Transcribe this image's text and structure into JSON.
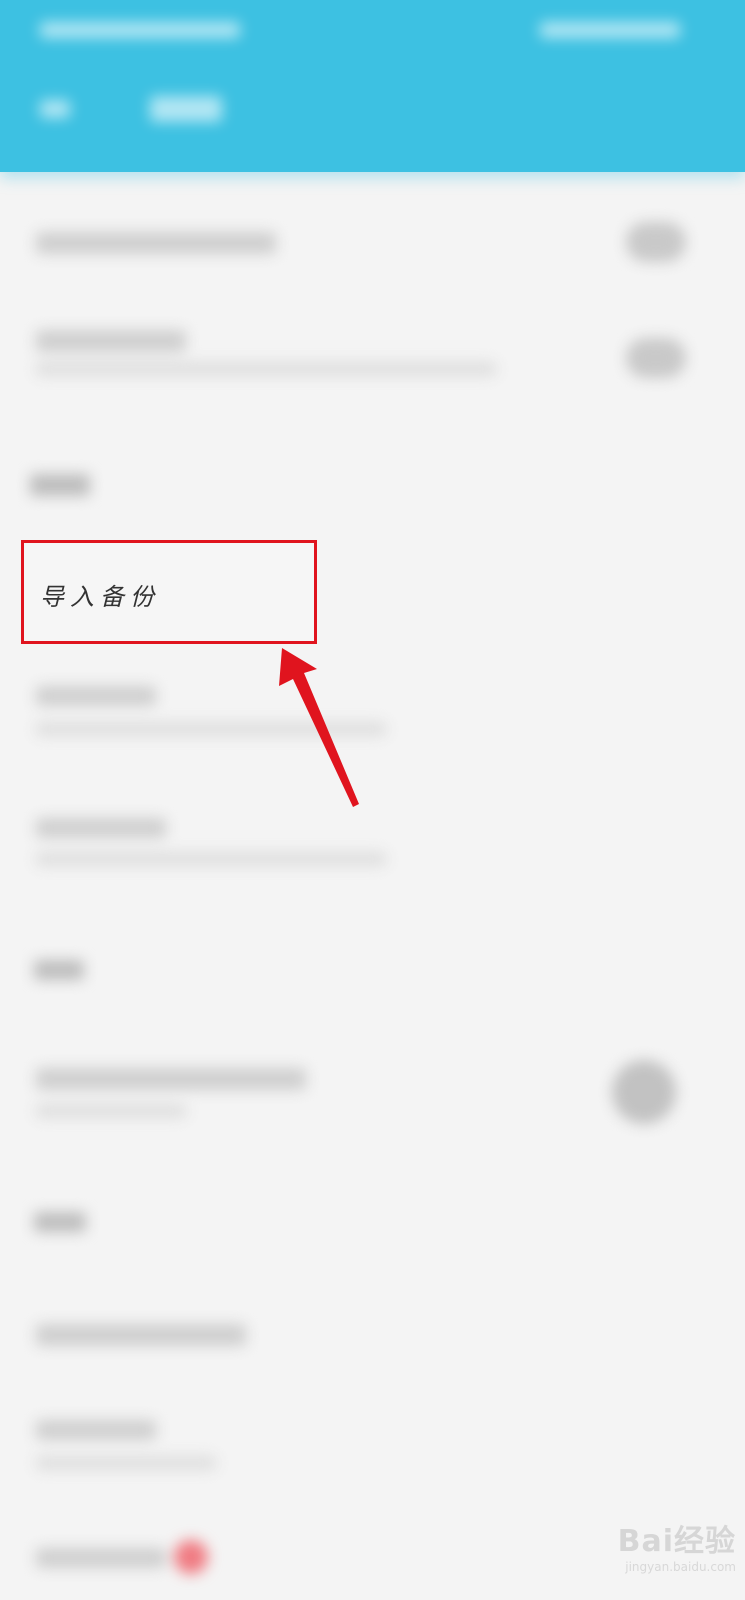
{
  "highlighted_item": {
    "label": "导入备份"
  },
  "watermark": {
    "brand": "Bai经验",
    "sub": "jingyan.baidu.com"
  },
  "colors": {
    "header": "#3dc1e2",
    "highlight_border": "#e0141e",
    "arrow": "#e0141e",
    "background": "#f4f4f4"
  },
  "icons": {
    "back": "arrow-left-icon",
    "pointer": "red-arrow-annotation"
  }
}
